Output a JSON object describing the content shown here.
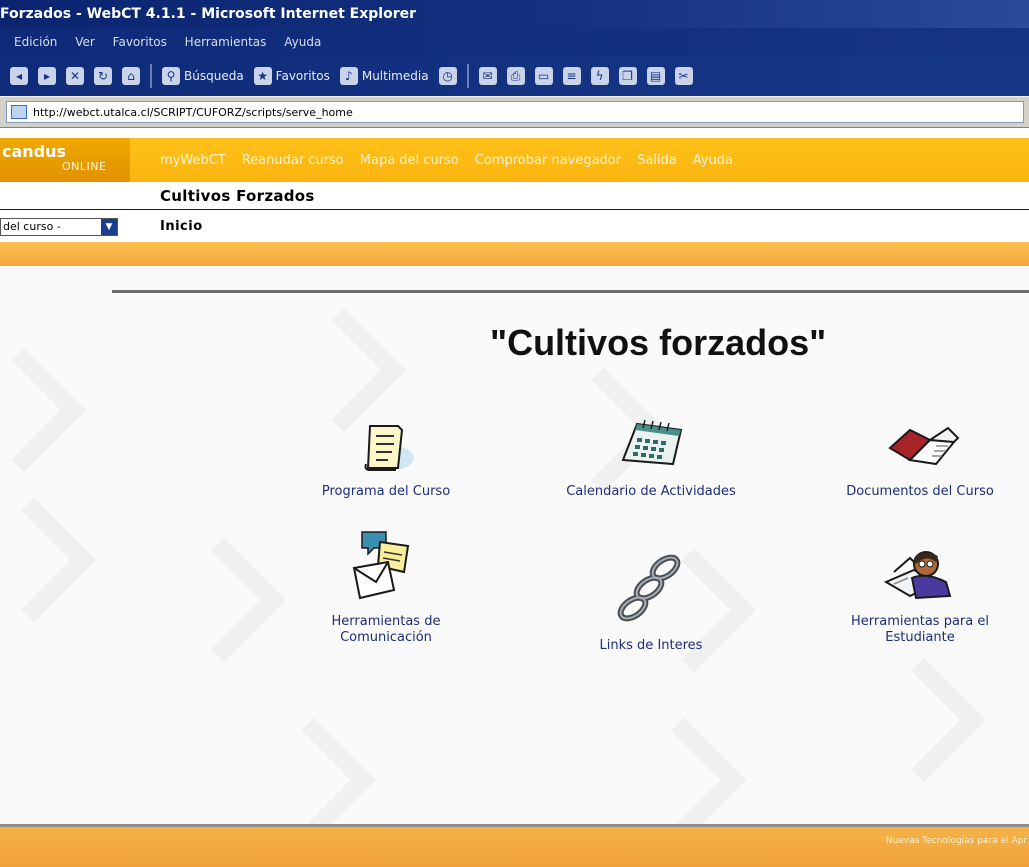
{
  "window": {
    "title": "Forzados - WebCT 4.1.1 - Microsoft Internet Explorer"
  },
  "menu": [
    "Edición",
    "Ver",
    "Favoritos",
    "Herramientas",
    "Ayuda"
  ],
  "toolbar": {
    "search_label": "Búsqueda",
    "favorites_label": "Favoritos",
    "multimedia_label": "Multimedia"
  },
  "address": {
    "url": "http://webct.utalca.cl/SCRIPT/CUFORZ/scripts/serve_home"
  },
  "brand": {
    "name": "candus",
    "sub": "ONLINE"
  },
  "nav": {
    "mywebct": "myWebCT",
    "reanudar": "Reanudar curso",
    "mapa": "Mapa del curso",
    "comprobar": "Comprobar navegador",
    "salida": "Salida",
    "ayuda": "Ayuda"
  },
  "course": {
    "title": "Cultivos Forzados",
    "select_value": "del curso -",
    "breadcrumb": "Inicio"
  },
  "home": {
    "title": "\"Cultivos forzados\"",
    "tiles": {
      "programa": "Programa del Curso",
      "calendario": "Calendario de Actividades",
      "documentos": "Documentos del Curso",
      "comunicacion_1": "Herramientas de",
      "comunicacion_2": "Comunicación",
      "links": "Links de Interes",
      "estudiante_1": "Herramientas para el",
      "estudiante_2": "Estudiante"
    }
  },
  "footer": {
    "text": "Nuevas Tecnologías para el Apr"
  },
  "colors": {
    "gold": "#fab40f",
    "orange": "#f3a83c",
    "navy": "#14317f",
    "link": "#1c2d7a"
  }
}
